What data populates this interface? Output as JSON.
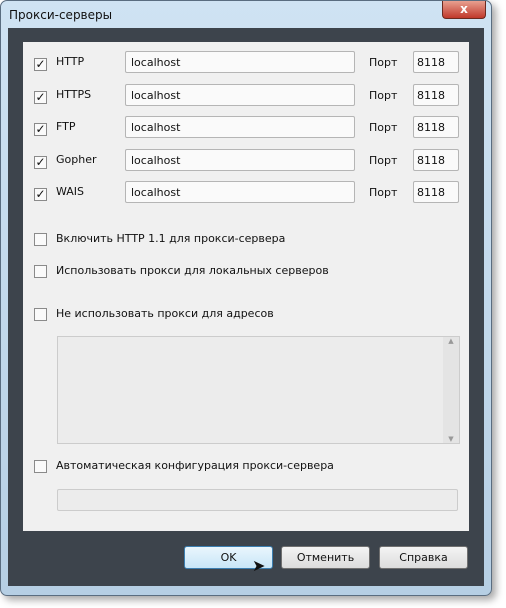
{
  "window": {
    "title": "Прокси-серверы",
    "close": "x"
  },
  "proxies": [
    {
      "label": "HTTP",
      "checked": true,
      "host": "localhost",
      "port_label": "Порт",
      "port": "8118"
    },
    {
      "label": "HTTPS",
      "checked": true,
      "host": "localhost",
      "port_label": "Порт",
      "port": "8118"
    },
    {
      "label": "FTP",
      "checked": true,
      "host": "localhost",
      "port_label": "Порт",
      "port": "8118"
    },
    {
      "label": "Gopher",
      "checked": true,
      "host": "localhost",
      "port_label": "Порт",
      "port": "8118"
    },
    {
      "label": "WAIS",
      "checked": true,
      "host": "localhost",
      "port_label": "Порт",
      "port": "8118"
    }
  ],
  "options": {
    "http11": "Включить HTTP 1.1 для прокси-сервера",
    "local": "Использовать прокси для локальных серверов",
    "bypass": "Не использовать прокси для адресов",
    "auto": "Автоматическая конфигурация прокси-сервера"
  },
  "check_mark": "✓",
  "buttons": {
    "ok": "OK",
    "cancel": "Отменить",
    "help": "Справка"
  }
}
